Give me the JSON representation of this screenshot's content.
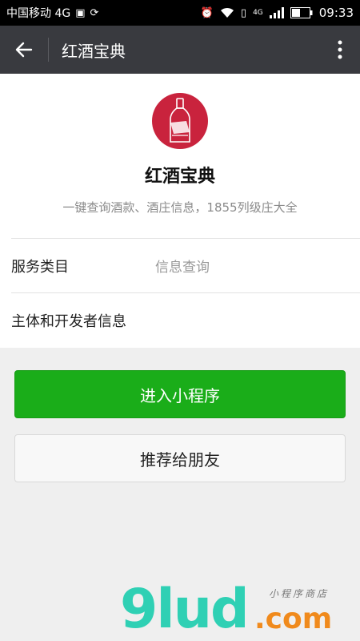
{
  "status_bar": {
    "carrier": "中国移动 4G",
    "network": "4G",
    "time": "09:33"
  },
  "title_bar": {
    "back_icon": "back-arrow-icon",
    "title": "红酒宝典",
    "more_icon": "more-vertical-icon"
  },
  "profile": {
    "logo_icon": "wine-bottle-icon",
    "logo_color": "#c9233d",
    "name": "红酒宝典",
    "description": "一键查询酒款、酒庄信息，1855列级庄大全"
  },
  "rows": [
    {
      "label": "服务类目",
      "value": "信息查询"
    },
    {
      "label": "主体和开发者信息",
      "value": ""
    }
  ],
  "buttons": {
    "enter": "进入小程序",
    "recommend": "推荐给朋友"
  },
  "watermark": {
    "logo": "9lud",
    "suffix": ".com",
    "tagline": "小程序商店"
  },
  "colors": {
    "primary_green": "#1aad19",
    "titlebar": "#393a3f"
  }
}
